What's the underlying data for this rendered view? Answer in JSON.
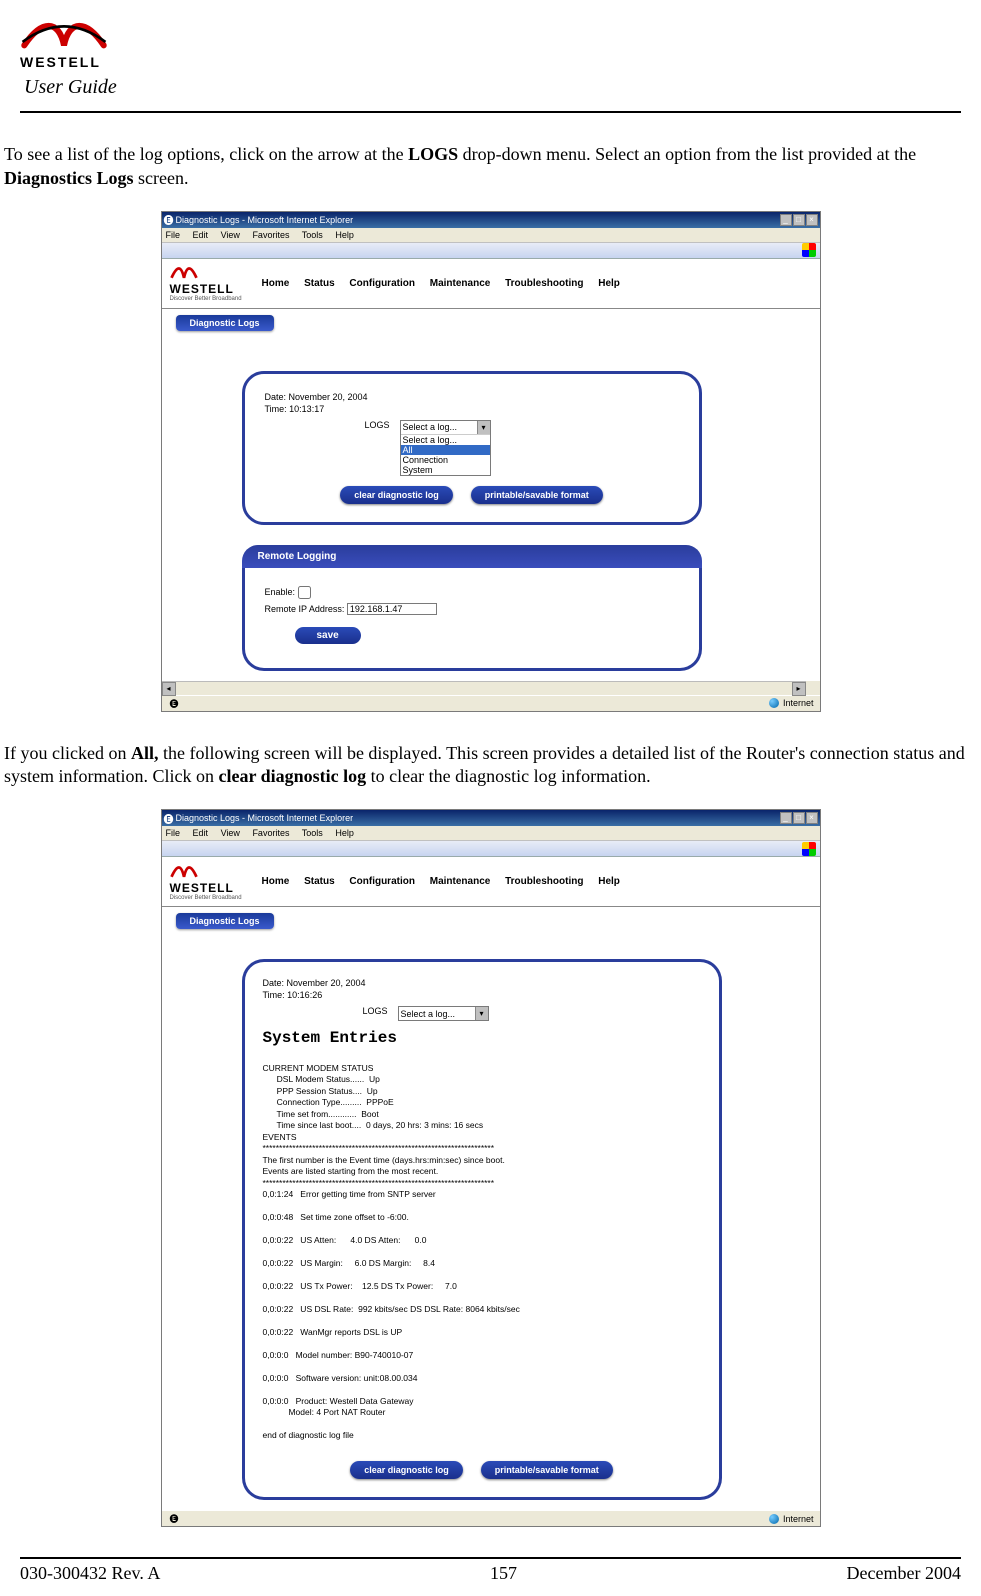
{
  "header": {
    "brand": "WESTELL",
    "user_guide": "User Guide"
  },
  "para1_a": "To see a list of the log options, click on the arrow at the ",
  "para1_b": "LOGS",
  "para1_c": " drop-down menu. Select an option from the list provided at the ",
  "para1_d": "Diagnostics Logs",
  "para1_e": " screen.",
  "para2_a": "If you clicked on ",
  "para2_b": "All,",
  "para2_c": " the following screen will be displayed. This screen provides a detailed list of the Router's connection status and system information. Click on ",
  "para2_d": "clear diagnostic log",
  "para2_e": " to clear the diagnostic log information.",
  "ie": {
    "title": "Diagnostic Logs - Microsoft Internet Explorer",
    "menu": [
      "File",
      "Edit",
      "View",
      "Favorites",
      "Tools",
      "Help"
    ],
    "status_internet": "Internet"
  },
  "westell": {
    "brand": "WESTELL",
    "tag": "Discover Better Broadband",
    "nav": [
      "Home",
      "Status",
      "Configuration",
      "Maintenance",
      "Troubleshooting",
      "Help"
    ],
    "tab": "Diagnostic Logs"
  },
  "shot1": {
    "date": "Date: November 20, 2004",
    "time": "Time: 10:13:17",
    "logs_label": "LOGS",
    "dd_value": "Select a log...",
    "dd_options": [
      "Select a log...",
      "All",
      "Connection",
      "System"
    ],
    "btn_clear": "clear diagnostic log",
    "btn_print": "printable/savable format",
    "remote_header": "Remote Logging",
    "enable_label": "Enable:",
    "ip_label": "Remote IP Address:",
    "ip_value": "192.168.1.47",
    "save": "save"
  },
  "shot2": {
    "date": "Date: November 20, 2004",
    "time": "Time: 10:16:26",
    "logs_label": "LOGS",
    "dd_value": "Select a log...",
    "sys_entries": "System Entries",
    "body": "CURRENT MODEM STATUS\n      DSL Modem Status......  Up\n      PPP Session Status....  Up\n      Connection Type.........  PPPoE\n      Time set from............  Boot\n      Time since last boot....  0 days, 20 hrs: 3 mins: 16 secs\nEVENTS\n**********************************************************************\nThe first number is the Event time (days.hrs:min:sec) since boot.\nEvents are listed starting from the most recent.\n**********************************************************************\n0,0:1:24   Error getting time from SNTP server\n\n0,0:0:48   Set time zone offset to -6:00.\n\n0,0:0:22   US Atten:      4.0 DS Atten:      0.0\n\n0,0:0:22   US Margin:     6.0 DS Margin:     8.4\n\n0,0:0:22   US Tx Power:    12.5 DS Tx Power:     7.0\n\n0,0:0:22   US DSL Rate:  992 kbits/sec DS DSL Rate: 8064 kbits/sec\n\n0,0:0:22   WanMgr reports DSL is UP\n\n0,0:0:0   Model number: B90-740010-07\n\n0,0:0:0   Software version: unit:08.00.034\n\n0,0:0:0   Product: Westell Data Gateway\n           Model: 4 Port NAT Router\n\nend of diagnostic log file",
    "btn_clear": "clear diagnostic log",
    "btn_print": "printable/savable format"
  },
  "footer": {
    "left": "030-300432 Rev. A",
    "center": "157",
    "right": "December 2004"
  }
}
